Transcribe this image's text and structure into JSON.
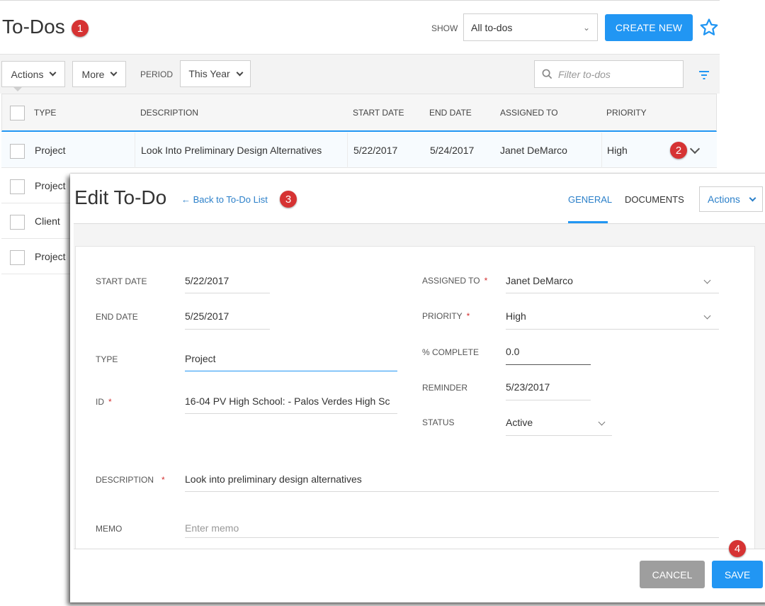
{
  "page": {
    "title": "To-Dos",
    "title_badge": "1",
    "show_label": "SHOW",
    "show_value": "All to-dos",
    "create_label": "CREATE NEW"
  },
  "toolbar": {
    "actions_label": "Actions",
    "more_label": "More",
    "period_label": "PERIOD",
    "period_value": "This Year",
    "filter_placeholder": "Filter to-dos"
  },
  "grid": {
    "columns": [
      "TYPE",
      "DESCRIPTION",
      "START DATE",
      "END DATE",
      "ASSIGNED TO",
      "PRIORITY"
    ],
    "rows": [
      {
        "type": "Project",
        "description": "Look Into Preliminary Design Alternatives",
        "start": "5/22/2017",
        "end": "5/24/2017",
        "assigned": "Janet DeMarco",
        "priority": "High"
      },
      {
        "type": "Project"
      },
      {
        "type": "Client"
      },
      {
        "type": "Project"
      }
    ],
    "row_badge": "2"
  },
  "dialog": {
    "title": "Edit To-Do",
    "back_link": "← Back to To-Do List",
    "back_badge": "3",
    "tabs": [
      "GENERAL",
      "DOCUMENTS"
    ],
    "actions_label": "Actions",
    "fields": {
      "start_date": {
        "label": "START DATE",
        "value": "5/22/2017"
      },
      "end_date": {
        "label": "END DATE",
        "value": "5/25/2017"
      },
      "type": {
        "label": "TYPE",
        "value": "Project"
      },
      "id": {
        "label": "ID",
        "value": "16-04 PV High School: - Palos Verdes High Sc"
      },
      "assigned_to": {
        "label": "ASSIGNED TO",
        "value": "Janet DeMarco"
      },
      "priority": {
        "label": "PRIORITY",
        "value": "High"
      },
      "percent_complete": {
        "label": "% COMPLETE",
        "value": "0.0"
      },
      "reminder": {
        "label": "REMINDER",
        "value": "5/23/2017"
      },
      "status": {
        "label": "STATUS",
        "value": "Active"
      },
      "description": {
        "label": "DESCRIPTION",
        "value": "Look into preliminary design alternatives"
      },
      "memo": {
        "label": "MEMO",
        "placeholder": "Enter memo"
      }
    },
    "required_mark": "*",
    "save_badge": "4",
    "cancel_label": "CANCEL",
    "save_label": "SAVE"
  },
  "colors": {
    "accent": "#2196f3",
    "link": "#2a7fc9",
    "badge": "#d63333",
    "cancel": "#9e9e9e"
  },
  "icons": [
    "star-icon",
    "search-icon",
    "filter-icon",
    "chevron-down-icon",
    "arrow-left-icon"
  ]
}
